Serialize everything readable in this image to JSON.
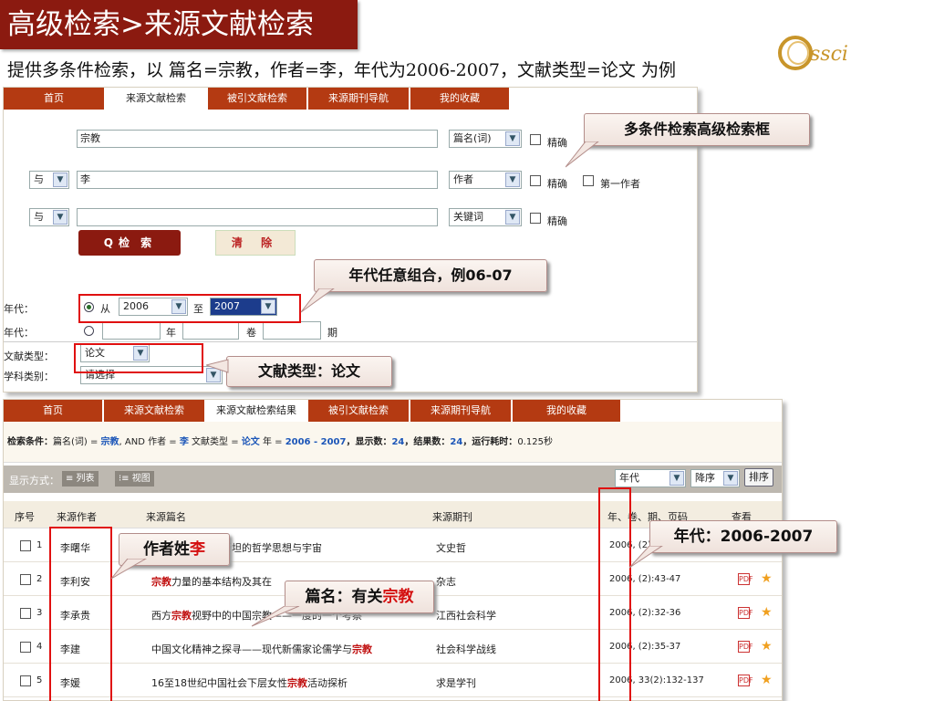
{
  "slide": {
    "title": "高级检索>来源文献检索",
    "subtitle": "提供多条件检索，以 篇名=宗教，作者=李，年代为2006-2007，文献类型=论文 为例",
    "logo_text": "Cssci"
  },
  "top_nav": [
    {
      "label": "首页",
      "active": false
    },
    {
      "label": "来源文献检索",
      "active": true
    },
    {
      "label": "被引文献检索",
      "active": false
    },
    {
      "label": "来源期刊导航",
      "active": false
    },
    {
      "label": "我的收藏",
      "active": false
    }
  ],
  "search_form": {
    "row1": {
      "value": "宗教",
      "field": "篇名(词)",
      "exact_label": "精确"
    },
    "row2": {
      "logic": "与",
      "value": "李",
      "field": "作者",
      "exact_label": "精确",
      "first_author_label": "第一作者"
    },
    "row3": {
      "logic": "与",
      "value": "",
      "field": "关键词",
      "exact_label": "精确"
    },
    "search_button": "检 索",
    "clear_button": "清 除"
  },
  "filters": {
    "year_label": "年代：",
    "from_label": "从",
    "year_from": "2006",
    "to_label": "至",
    "year_to": "2007",
    "year2_label": "年代：",
    "year_unit": "年",
    "volume_unit": "卷",
    "issue_unit": "期",
    "doc_type_label": "文献类型：",
    "doc_type_value": "论文",
    "subject_label": "学科类别：",
    "subject_value": "请选择"
  },
  "callouts": {
    "advanced_box": "多条件检索高级检索框",
    "year_combo": "年代任意组合，例06-07",
    "doc_type": "文献类型：论文",
    "author_prefix": "作者姓",
    "author_kw": "李",
    "title_prefix": "篇名：有关",
    "title_kw": "宗教",
    "year_range": "年代：2006-2007"
  },
  "results_nav": [
    {
      "label": "首页",
      "active": false
    },
    {
      "label": "来源文献检索",
      "active": false
    },
    {
      "label": "来源文献检索结果",
      "active": true
    },
    {
      "label": "被引文献检索",
      "active": false
    },
    {
      "label": "来源期刊导航",
      "active": false
    },
    {
      "label": "我的收藏",
      "active": false
    }
  ],
  "condition": {
    "label": "检索条件：",
    "field1": "篇名(词) = ",
    "val1": "宗教",
    "and1": ", AND 作者 = ",
    "val2": "李",
    "and2": " 文献类型 = ",
    "val3": "论文",
    "and3": " 年 = ",
    "val4": "2006 - 2007",
    "shown_label": "，显示数：",
    "shown": "24",
    "result_label": "，结果数：",
    "result": "24",
    "time_label": "，运行耗时：",
    "time": "0.125秒"
  },
  "display": {
    "mode_label": "显示方式：",
    "list_label": "≡ 列表",
    "view_label": "⁝≡ 视图",
    "sort_field": "年代",
    "sort_order": "降序",
    "sort_button": "排序"
  },
  "table": {
    "headers": [
      "序号",
      "来源作者",
      "来源篇名",
      "来源期刊",
      "年、卷、期、页码",
      "查看"
    ],
    "rows": [
      {
        "num": "1",
        "author": "李曙华",
        "title_pre": "",
        "title_kw": "",
        "title_post": "可能？——爱因斯坦的哲学思想与宇宙",
        "journal": "文史哲",
        "ref": "2006, (2)"
      },
      {
        "num": "2",
        "author": "李利安",
        "title_pre": "",
        "title_kw": "宗教",
        "title_post": "力量的基本结构及其在",
        "journal": "杂志",
        "ref": "2006, (2):43-47"
      },
      {
        "num": "3",
        "author": "李承贵",
        "title_pre": "西方",
        "title_kw": "宗教",
        "title_post": "视野中的中国宗教——一度的一个考察",
        "journal": "江西社会科学",
        "ref": "2006, (2):32-36"
      },
      {
        "num": "4",
        "author": "李建",
        "title_pre": "中国文化精神之探寻——现代新儒家论儒学与",
        "title_kw": "宗教",
        "title_post": "",
        "journal": "社会科学战线",
        "ref": "2006, (2):35-37"
      },
      {
        "num": "5",
        "author": "李媛",
        "title_pre": "16至18世纪中国社会下层女性",
        "title_kw": "宗教",
        "title_post": "活动探析",
        "journal": "求是学刊",
        "ref": "2006, 33(2):132-137"
      }
    ]
  },
  "colors": {
    "brand": "#8b1a10",
    "nav": "#b43a12",
    "highlight": "#e01010"
  }
}
